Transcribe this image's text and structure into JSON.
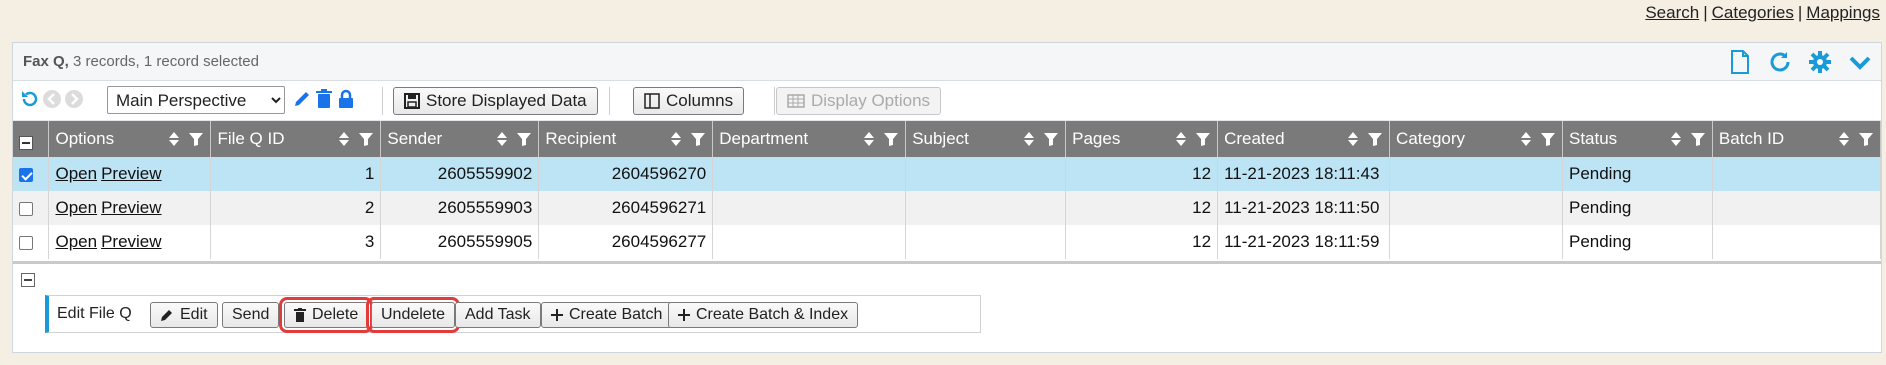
{
  "top_links": {
    "search": "Search",
    "categories": "Categories",
    "mappings": "Mappings",
    "separator": "|"
  },
  "panel": {
    "title": "Fax Q,",
    "subtitle": "3 records, 1 record selected",
    "header_icons": [
      "document-icon",
      "refresh-icon",
      "gear-icon",
      "chevron-down-icon"
    ]
  },
  "toolbar": {
    "perspective_selected": "Main Perspective",
    "store_label": "Store Displayed Data",
    "columns_label": "Columns",
    "display_options_label": "Display Options"
  },
  "table": {
    "headers": [
      "Options",
      "File Q ID",
      "Sender",
      "Recipient",
      "Department",
      "Subject",
      "Pages",
      "Created",
      "Category",
      "Status",
      "Batch ID"
    ],
    "rows": [
      {
        "checked": true,
        "open": "Open",
        "preview": "Preview",
        "file_q_id": "1",
        "sender": "2605559902",
        "recipient": "2604596270",
        "department": "",
        "subject": "",
        "pages": "12",
        "created": "11-21-2023 18:11:43",
        "category": "",
        "status": "Pending",
        "batch_id": ""
      },
      {
        "checked": false,
        "open": "Open",
        "preview": "Preview",
        "file_q_id": "2",
        "sender": "2605559903",
        "recipient": "2604596271",
        "department": "",
        "subject": "",
        "pages": "12",
        "created": "11-21-2023 18:11:50",
        "category": "",
        "status": "Pending",
        "batch_id": ""
      },
      {
        "checked": false,
        "open": "Open",
        "preview": "Preview",
        "file_q_id": "3",
        "sender": "2605559905",
        "recipient": "2604596277",
        "department": "",
        "subject": "",
        "pages": "12",
        "created": "11-21-2023 18:11:59",
        "category": "",
        "status": "Pending",
        "batch_id": ""
      }
    ]
  },
  "edit_bar": {
    "label": "Edit File Q",
    "edit": "Edit",
    "send": "Send",
    "delete": "Delete",
    "undelete": "Undelete",
    "add_task": "Add Task",
    "create_batch": "Create Batch",
    "create_batch_index": "Create Batch & Index"
  },
  "colors": {
    "accent": "#1a9bd7",
    "header_bg": "#7a7a7a",
    "selected_row": "#bde4f4",
    "highlight": "#e23b3b"
  }
}
